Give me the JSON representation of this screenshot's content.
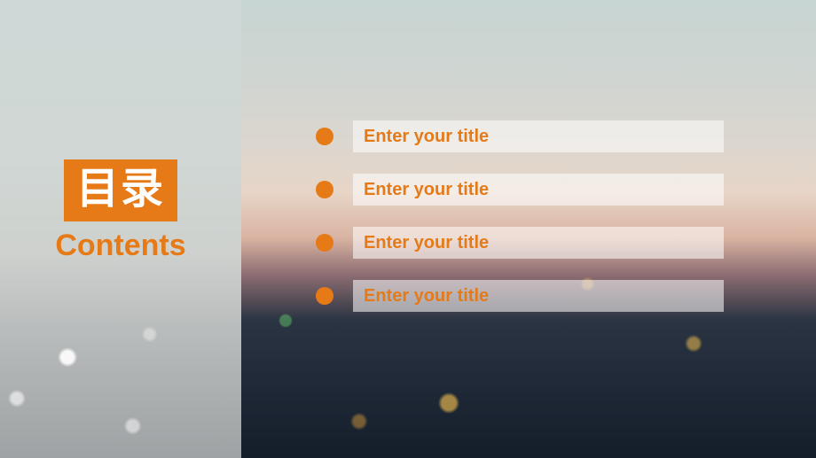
{
  "colors": {
    "accent": "#e67a17",
    "bar_bg": "rgba(255,255,255,0.55)"
  },
  "sidebar": {
    "title": "目录",
    "subtitle": "Contents"
  },
  "toc": {
    "items": [
      {
        "label": "Enter your title"
      },
      {
        "label": "Enter your title"
      },
      {
        "label": "Enter your title"
      },
      {
        "label": "Enter your title"
      }
    ]
  }
}
